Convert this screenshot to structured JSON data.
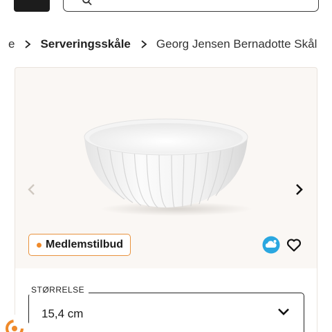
{
  "breadcrumb": {
    "cut_item": "e",
    "parent": "Serveringsskåle",
    "current": "Georg Jensen Bernadotte Skål"
  },
  "product": {
    "badge": "Medlemstilbud",
    "size_label": "STØRRELSE",
    "size_value": "15,4 cm"
  },
  "colors": {
    "accent": "#ef8a2b",
    "dark": "#1c1c1c",
    "card_bg": "#faf7f4",
    "cloud_blue": "#2aa7e0"
  },
  "icons": [
    "menu-icon",
    "search-icon",
    "chevron-right-icon",
    "chevron-left-icon",
    "heart-icon",
    "weather-cloud-icon",
    "chevron-down-icon",
    "loyalty-icon"
  ]
}
